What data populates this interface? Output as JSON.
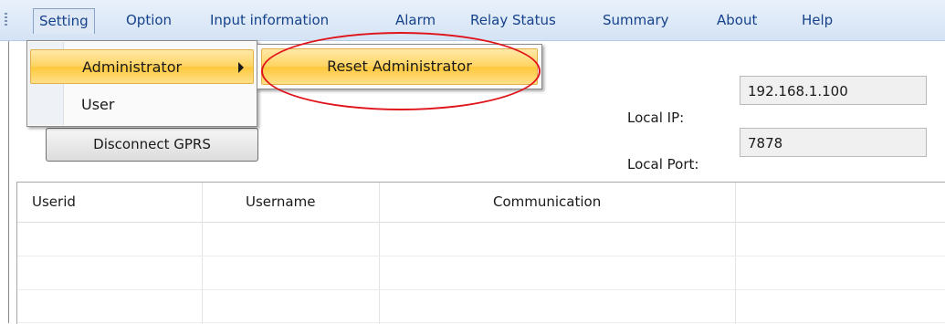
{
  "menubar": {
    "items": [
      {
        "label": "Setting"
      },
      {
        "label": "Option"
      },
      {
        "label": "Input information"
      },
      {
        "label": "Alarm"
      },
      {
        "label": "Relay Status"
      },
      {
        "label": "Summary"
      },
      {
        "label": "About"
      },
      {
        "label": "Help"
      }
    ]
  },
  "setting_menu": {
    "items": [
      {
        "label": "Administrator",
        "has_submenu": true
      },
      {
        "label": "User"
      }
    ]
  },
  "administrator_submenu": {
    "items": [
      {
        "label": "Reset Administrator"
      }
    ]
  },
  "connection": {
    "local_ip_label": "Local   IP:",
    "local_ip_value": "192.168.1.100",
    "local_port_label": "Local Port:",
    "local_port_value": "7878",
    "disconnect_button": "Disconnect GPRS"
  },
  "table": {
    "columns": [
      "Userid",
      "Username",
      "Communication",
      ""
    ],
    "rows": [
      [
        "",
        "",
        "",
        ""
      ],
      [
        "",
        "",
        "",
        ""
      ],
      [
        "",
        "",
        "",
        ""
      ]
    ]
  },
  "colors": {
    "menu_text": "#15428b",
    "highlight": "#ffd35f",
    "annotation": "#e0131a"
  }
}
